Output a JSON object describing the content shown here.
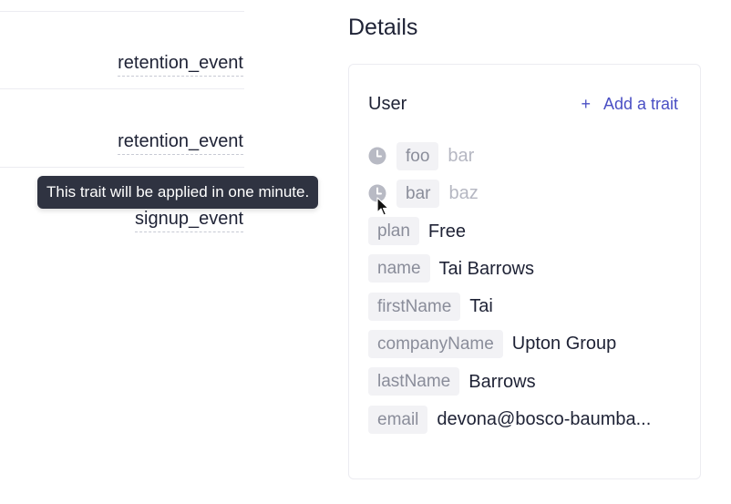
{
  "events": [
    {
      "name": "retention_event"
    },
    {
      "name": "retention_event"
    },
    {
      "name": "signup_event"
    }
  ],
  "tooltip": {
    "text": "This trait will be applied in one minute."
  },
  "details": {
    "title": "Details",
    "card": {
      "title": "User",
      "add_trait_icon": "+",
      "add_trait_label": "Add a trait",
      "traits": [
        {
          "key": "foo",
          "value": "bar",
          "pending": true,
          "icon": "clock-icon"
        },
        {
          "key": "bar",
          "value": "baz",
          "pending": true,
          "icon": "clock-icon"
        },
        {
          "key": "plan",
          "value": "Free"
        },
        {
          "key": "name",
          "value": "Tai Barrows"
        },
        {
          "key": "firstName",
          "value": "Tai"
        },
        {
          "key": "companyName",
          "value": "Upton Group"
        },
        {
          "key": "lastName",
          "value": "Barrows"
        },
        {
          "key": "email",
          "value": "devona@bosco-baumba..."
        }
      ]
    }
  },
  "colors": {
    "accent": "#4a4fc4",
    "tooltip_bg": "#2f3341",
    "chip_bg": "#f2f2f5",
    "pending_text": "#b5b7c2"
  }
}
